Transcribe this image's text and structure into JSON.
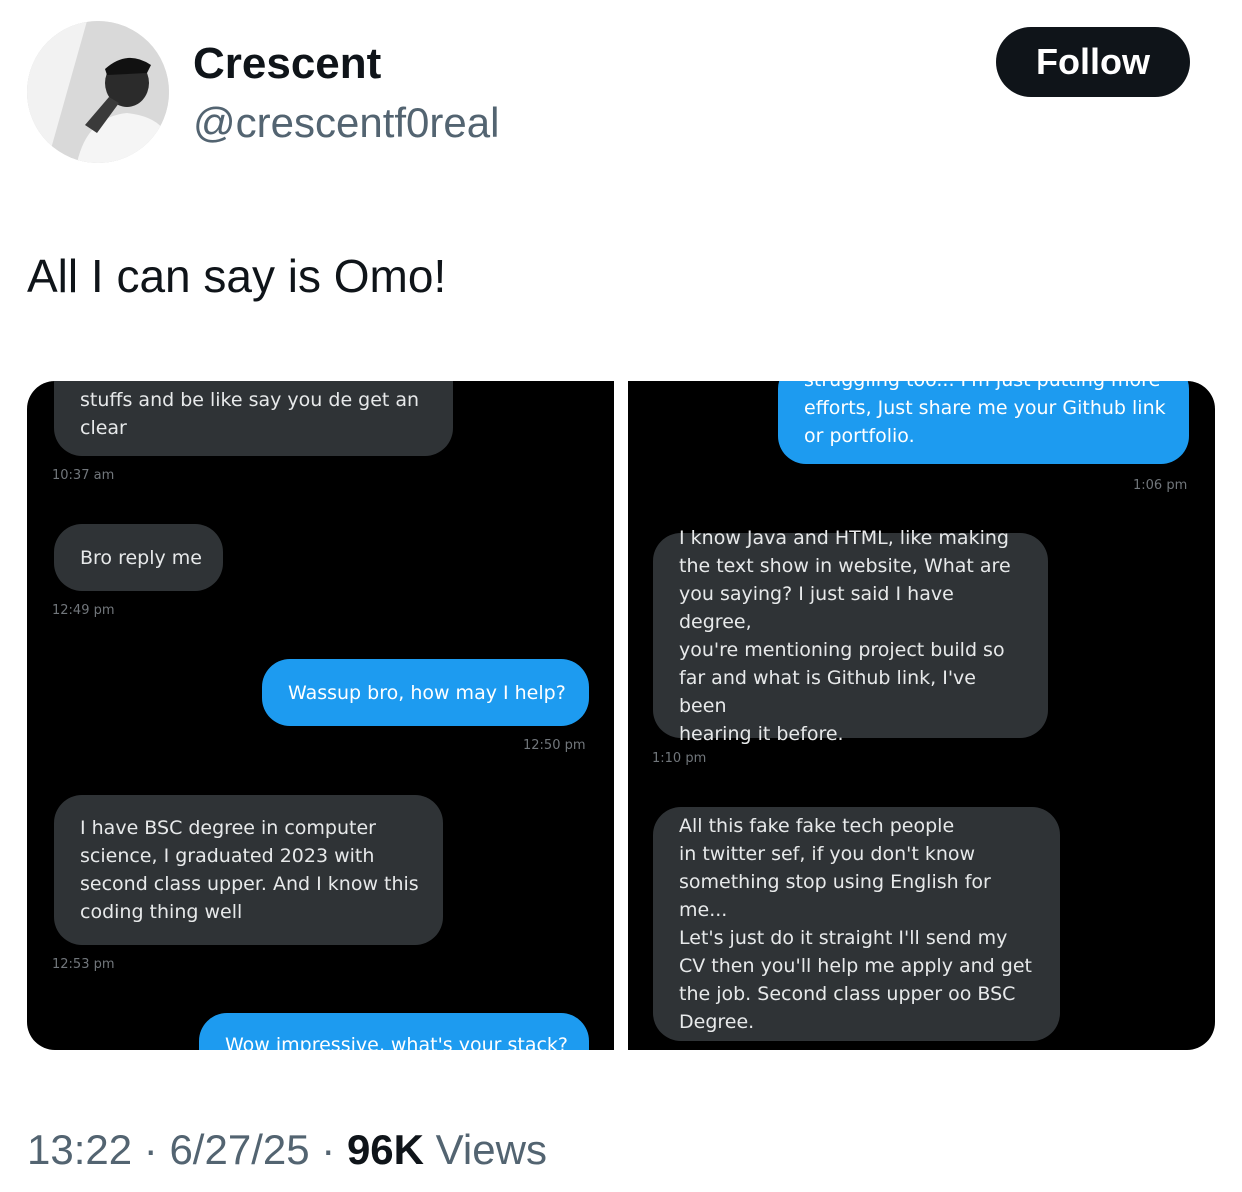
{
  "author": {
    "name": "Crescent",
    "handle": "@crescentf0real"
  },
  "follow_label": "Follow",
  "tweet_text": "All I can say is Omo!",
  "left_chat": {
    "messages": [
      {
        "text": "stuffs and be like say you de get an\nclear",
        "from": "received",
        "time": "10:37 am"
      },
      {
        "text": "Bro reply me",
        "from": "received",
        "time": "12:49 pm"
      },
      {
        "text": "Wassup bro, how may I help?",
        "from": "sent",
        "time": "12:50 pm"
      },
      {
        "text": "I have BSC degree in computer\nscience, I graduated 2023 with\nsecond class upper. And I know this\ncoding thing well",
        "from": "received",
        "time": "12:53 pm"
      },
      {
        "text": "Wow impressive, what's your stack?",
        "from": "sent",
        "time": ""
      }
    ]
  },
  "right_chat": {
    "messages": [
      {
        "text": "struggling too... I'm just putting more\nefforts, Just share me your Github link\nor portfolio.",
        "from": "sent",
        "time": "1:06 pm"
      },
      {
        "text": "I know Java and HTML, like making\nthe text show in website, What are\nyou saying? I just said I have degree,\nyou're mentioning project build so\nfar and what is Github link, I've been\nhearing it before.",
        "from": "received",
        "time": "1:10 pm"
      },
      {
        "text": "All this fake fake tech people\nin twitter sef, if you don't know\nsomething stop using English for me...\nLet's just do it straight I'll send my\nCV then you'll help me apply and get\nthe job. Second class upper oo BSC\nDegree.",
        "from": "received",
        "time": ""
      }
    ]
  },
  "meta": {
    "time": "13:22",
    "date": "6/27/25",
    "views_count": "96K",
    "views_label": "Views",
    "separator": "·"
  },
  "colors": {
    "sent_bubble": "#1d9bf0",
    "received_bubble": "#2f3336",
    "chat_background": "#000000",
    "follow_button": "#0f1419"
  }
}
